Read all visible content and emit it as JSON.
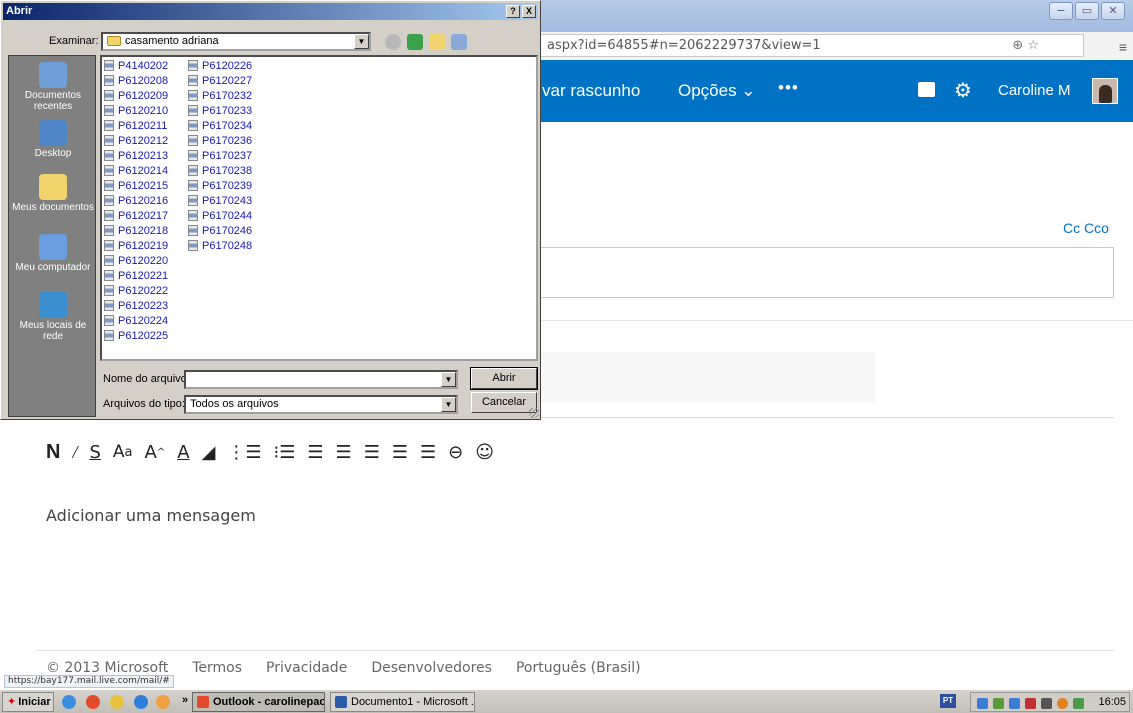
{
  "browser": {
    "address": "aspx?id=64855#n=2062229737&view=1",
    "address_icons": "⊕ ☆",
    "menu_icon": "≡",
    "window_buttons": [
      "−",
      "▭",
      "✕"
    ]
  },
  "outlook": {
    "save_draft": "var rascunho",
    "options": "Opções ⌄",
    "more": "•••",
    "user": "Caroline M",
    "cc_bcc": "Cc Cco",
    "message_placeholder": "Adicionar uma mensagem",
    "toolbar": [
      "N",
      "I",
      "S",
      "Aa",
      "A",
      "A",
      "✎",
      "☰",
      "☷",
      "⇥",
      "⇤",
      "≣",
      "≡",
      "≡",
      "⛓",
      "☺"
    ],
    "toolbar_glyphs": {
      "bold": "N",
      "italic": "I",
      "underline": "S",
      "font_size": "Aa",
      "grow": "A˄",
      "font_color": "A",
      "highlight": "◢",
      "numbered": "⁝≡",
      "bullets": "⁚≡",
      "outdent": "⇤",
      "indent": "⇥",
      "align_left": "≡",
      "align_center": "≡",
      "align_right": "≡",
      "link": "⊂⊃",
      "emoji": "☺"
    }
  },
  "footer": {
    "copyright": "© 2013 Microsoft",
    "links": [
      "Termos",
      "Privacidade",
      "Desenvolvedores",
      "Português (Brasil)"
    ],
    "status_url": "https://bay177.mail.live.com/mail/#"
  },
  "taskbar": {
    "start": "Iniciar",
    "tasks": [
      "Outlook - carolinepao...",
      "Documento1 - Microsoft ..."
    ],
    "language": "PT",
    "clock": "16:05",
    "overflow": "»"
  },
  "dialog": {
    "title": "Abrir",
    "title_buttons": [
      "?",
      "X"
    ],
    "lookin_label": "Examinar:",
    "lookin_value": "casamento adriana",
    "places": [
      "Documentos recentes",
      "Desktop",
      "Meus documentos",
      "Meu computador",
      "Meus locais de rede"
    ],
    "files_col1": [
      "P4140202",
      "P6120208",
      "P6120209",
      "P6120210",
      "P6120211",
      "P6120212",
      "P6120213",
      "P6120214",
      "P6120215",
      "P6120216",
      "P6120217",
      "P6120218",
      "P6120219",
      "P6120220",
      "P6120221",
      "P6120222",
      "P6120223",
      "P6120224",
      "P6120225"
    ],
    "files_col2": [
      "P6120226",
      "P6120227",
      "P6170232",
      "P6170233",
      "P6170234",
      "P6170236",
      "P6170237",
      "P6170238",
      "P6170239",
      "P6170243",
      "P6170244",
      "P6170246",
      "P6170248"
    ],
    "filename_label": "Nome do arquivo:",
    "filename_value": "",
    "filetype_label": "Arquivos do tipo:",
    "filetype_value": "Todos os arquivos",
    "open_button": "Abrir",
    "cancel_button": "Cancelar"
  }
}
